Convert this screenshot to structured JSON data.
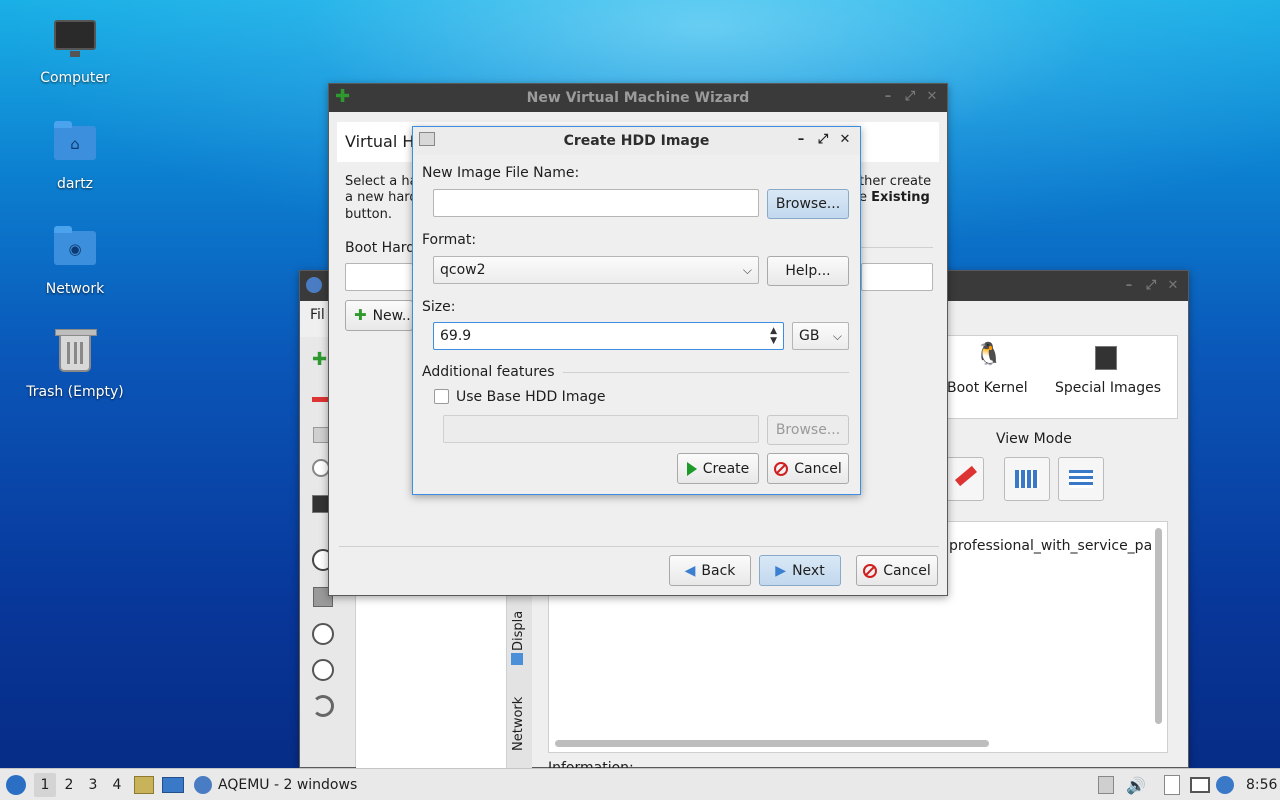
{
  "desktop": {
    "icons": [
      {
        "label": "Computer"
      },
      {
        "label": "dartz"
      },
      {
        "label": "Network"
      },
      {
        "label": "Trash (Empty)"
      }
    ]
  },
  "aqemu": {
    "menu_file": "Fil",
    "device_labels": [
      "Boot Kernel",
      "Special Images"
    ],
    "view_mode_label": "View Mode",
    "vm_name_partial": "professional_with_service_pa",
    "info_partial": "Information:",
    "side_tabs": [
      "Displa",
      "Network"
    ]
  },
  "wizard": {
    "title": "New Virtual Machine Wizard",
    "heading": "Virtual Ha",
    "desc_left_1": "Select a har",
    "desc_left_2": "a new hard",
    "desc_left_3": "button.",
    "desc_right_1": "ther create",
    "desc_right_2a": "e",
    "desc_right_2b": "Existing",
    "boot_hard_label": "Boot Hard",
    "new_button": "New...",
    "back_button": "Back",
    "next_button": "Next",
    "cancel_button": "Cancel"
  },
  "hdd_dialog": {
    "title": "Create HDD Image",
    "file_name_label": "New Image File Name:",
    "file_name_value": "",
    "browse_button": "Browse...",
    "format_label": "Format:",
    "format_value": "qcow2",
    "help_button": "Help...",
    "size_label": "Size:",
    "size_value": "69.9",
    "size_unit": "GB",
    "additional_label": "Additional features",
    "use_base_label": "Use Base HDD Image",
    "use_base_checked": false,
    "base_browse_button": "Browse...",
    "create_button": "Create",
    "cancel_button": "Cancel"
  },
  "taskbar": {
    "workspaces": [
      "1",
      "2",
      "3",
      "4"
    ],
    "active_workspace": "1",
    "task_label": "AQEMU - 2 windows",
    "clock": "8:56"
  },
  "colors": {
    "accent": "#3d8ee0",
    "create_icon": "#1c9a2a",
    "cancel_icon": "#d01f1f"
  }
}
